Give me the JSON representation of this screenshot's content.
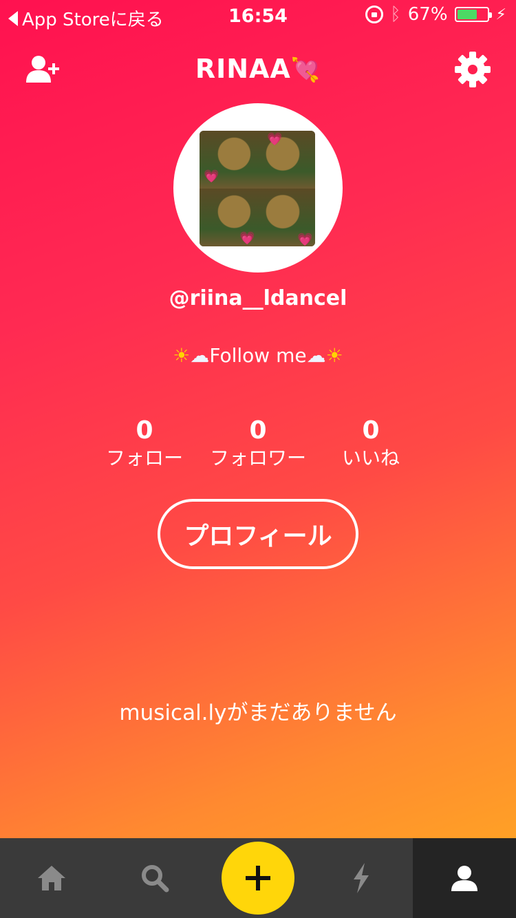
{
  "status_bar": {
    "back_label": "App Storeに戻る",
    "time": "16:54",
    "battery": "67%",
    "battery_level": 0.67,
    "icons": [
      "rotation-lock-icon",
      "bluetooth-icon",
      "battery-icon",
      "charging-icon"
    ]
  },
  "header": {
    "title": "RINAA",
    "title_emoji": "💘",
    "left_icon": "add-user-icon",
    "right_icon": "gear-icon"
  },
  "profile": {
    "handle": "@riina__ldancel",
    "bio_text": "Follow me",
    "bio_emoji_sun": "☀",
    "bio_emoji_cloud": "☁"
  },
  "stats": [
    {
      "value": "0",
      "label": "フォロー"
    },
    {
      "value": "0",
      "label": "フォロワー"
    },
    {
      "value": "0",
      "label": "いいね"
    }
  ],
  "profile_button": "プロフィール",
  "empty_message": "musical.lyがまだありません",
  "tabbar": {
    "items": [
      "home-icon",
      "search-icon",
      "add-icon",
      "lightning-icon",
      "profile-icon"
    ],
    "active": "profile-icon"
  },
  "colors": {
    "gradient_top": "#ff1150",
    "gradient_bottom": "#ffad20",
    "tabbar_bg": "#3a3a3a",
    "tabbar_active_bg": "#242424",
    "plus_button": "#ffd60a",
    "battery_fill": "#4cd964"
  }
}
